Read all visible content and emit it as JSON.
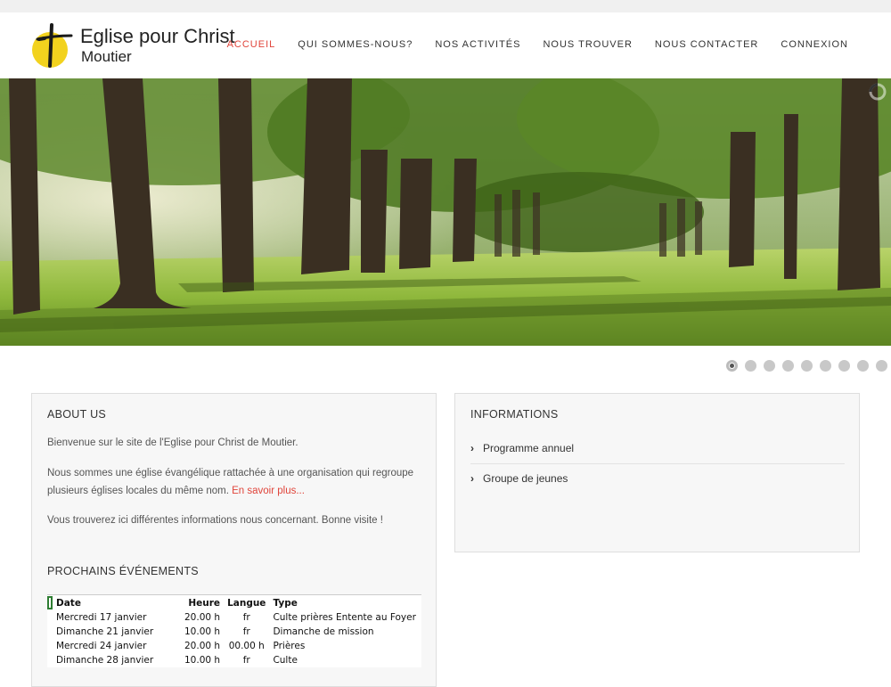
{
  "site": {
    "logo_title": "Eglise pour Christ",
    "logo_subtitle": "Moutier",
    "logo_icon": "cross-on-yellow-circle-icon",
    "accent_color": "#e0443a"
  },
  "nav": {
    "items": [
      {
        "label": "ACCUEIL",
        "active": true
      },
      {
        "label": "QUI SOMMES-NOUS?",
        "active": false
      },
      {
        "label": "NOS ACTIVITÉS",
        "active": false
      },
      {
        "label": "NOUS TROUVER",
        "active": false
      },
      {
        "label": "NOUS CONTACTER",
        "active": false
      },
      {
        "label": "CONNEXION",
        "active": false
      }
    ]
  },
  "slider": {
    "image": "tree-lined-avenue-park-photo",
    "slide_count": 9,
    "active_slide": 1,
    "loading_icon": "spinner-icon"
  },
  "about": {
    "heading": "ABOUT US",
    "p1": "Bienvenue sur le site de l'Eglise pour Christ de Moutier.",
    "p2_line1": "Nous sommes une église évangélique rattachée à une organisation qui regroupe",
    "p2_line2": "plusieurs églises locales du même nom.",
    "p2_link": "En savoir plus...",
    "p3": "Vous trouverez ici différentes informations nous concernant. Bonne visite !"
  },
  "informations": {
    "heading": "INFORMATIONS",
    "items": [
      {
        "label": "Programme annuel",
        "icon": "chevron-right-icon"
      },
      {
        "label": "Groupe de jeunes",
        "icon": "chevron-right-icon"
      }
    ]
  },
  "events": {
    "heading": "PROCHAINS ÉVÉNEMENTS",
    "columns": [
      "Date",
      "Heure",
      "Langue",
      "Type"
    ],
    "rows": [
      [
        "Mercredi 17 janvier",
        "20.00 h",
        "fr",
        "Culte prières Entente au Foyer"
      ],
      [
        "Dimanche 21 janvier",
        "10.00 h",
        "fr",
        "Dimanche de mission"
      ],
      [
        "Mercredi 24 janvier",
        "20.00 h",
        "00.00 h",
        "Prières"
      ],
      [
        "Dimanche 28 janvier",
        "10.00 h",
        "fr",
        "Culte"
      ]
    ]
  }
}
